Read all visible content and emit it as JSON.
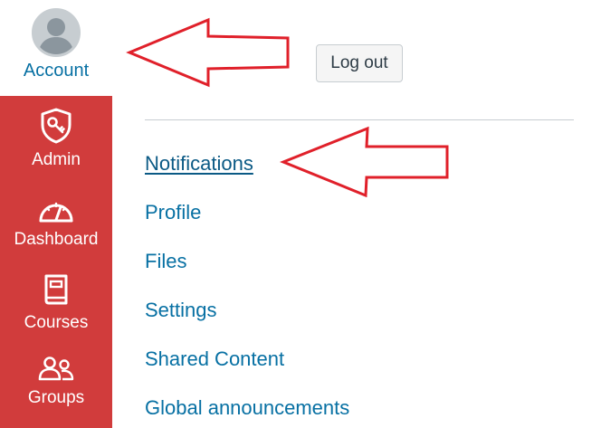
{
  "global_nav": {
    "account": {
      "label": "Account",
      "icon": "avatar-placeholder-icon"
    },
    "items": [
      {
        "label": "Admin",
        "icon": "shield-key-icon"
      },
      {
        "label": "Dashboard",
        "icon": "speedometer-icon"
      },
      {
        "label": "Courses",
        "icon": "book-icon"
      },
      {
        "label": "Groups",
        "icon": "people-icon"
      }
    ],
    "brand_color": "#d13c3c"
  },
  "account_tray": {
    "logout_label": "Log out",
    "links": [
      {
        "label": "Notifications",
        "active": true
      },
      {
        "label": "Profile"
      },
      {
        "label": "Files"
      },
      {
        "label": "Settings"
      },
      {
        "label": "Shared Content"
      },
      {
        "label": "Global announcements"
      }
    ],
    "link_color": "#0770a3"
  },
  "annotations": {
    "arrow_color": "#e0202a",
    "arrows": [
      {
        "points_to": "Account"
      },
      {
        "points_to": "Notifications"
      }
    ]
  }
}
